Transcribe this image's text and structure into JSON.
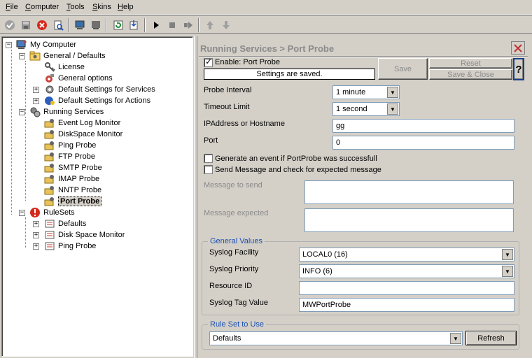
{
  "menu": [
    "File",
    "Computer",
    "Tools",
    "Skins",
    "Help"
  ],
  "tree": {
    "root": "My Computer",
    "general_defaults": "General / Defaults",
    "license": "License",
    "general_options": "General options",
    "default_services": "Default Settings for Services",
    "default_actions": "Default Settings for Actions",
    "running_services": "Running Services",
    "services": [
      "Event Log Monitor",
      "DiskSpace Monitor",
      "Ping Probe",
      "FTP Probe",
      "SMTP Probe",
      "IMAP Probe",
      "NNTP Probe",
      "Port Probe"
    ],
    "rulesets": "RuleSets",
    "ruleset_items": [
      "Defaults",
      "Disk Space Monitor",
      "Ping Probe"
    ]
  },
  "header": {
    "title": "Running Services  > Port Probe"
  },
  "enable": {
    "label": "Enable: Port Probe",
    "checked": true
  },
  "status": "Settings are saved.",
  "buttons": {
    "save": "Save",
    "reset": "Reset",
    "save_close": "Save & Close",
    "help": "?",
    "refresh": "Refresh"
  },
  "form": {
    "probe_interval_label": "Probe Interval",
    "probe_interval_value": "1 minute",
    "timeout_label": "Timeout Limit",
    "timeout_value": "1 second",
    "ip_label": "IPAddress or Hostname",
    "ip_value": "gg",
    "port_label": "Port",
    "port_value": "0",
    "generate_event_label": "Generate an event if PortProbe was successfull",
    "send_message_label": "Send Message and check for expected message",
    "message_send_label": "Message to send",
    "message_expected_label": "Message expected"
  },
  "general_values": {
    "title": "General Values",
    "facility_label": "Syslog Facility",
    "facility_value": "LOCAL0 (16)",
    "priority_label": "Syslog Priority",
    "priority_value": "INFO (6)",
    "resource_label": "Resource ID",
    "resource_value": "",
    "tag_label": "Syslog Tag Value",
    "tag_value": "MWPortProbe"
  },
  "ruleset": {
    "title": "Rule Set to Use",
    "value": "Defaults"
  }
}
